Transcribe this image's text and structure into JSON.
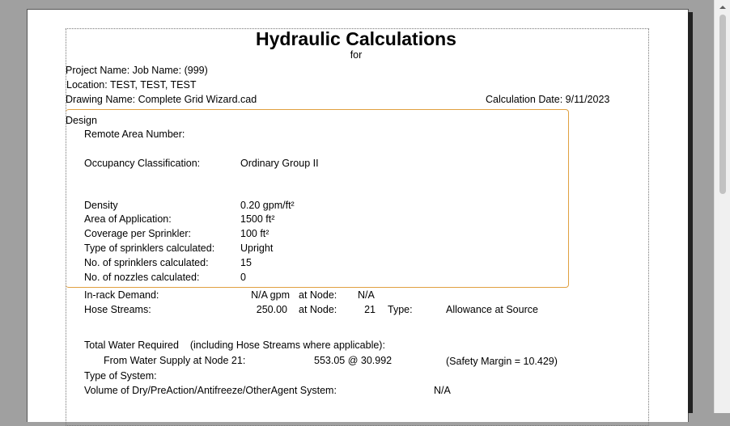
{
  "header": {
    "title": "Hydraulic Calculations",
    "subtitle": "for"
  },
  "project": {
    "project_name": "Project Name: Job Name: (999)",
    "location": "Location: TEST, TEST, TEST",
    "drawing_name": "Drawing Name: Complete Grid Wizard.cad",
    "calculation_date": "Calculation Date: 9/11/2023"
  },
  "design": {
    "heading": "Design",
    "remote_area_label": "Remote Area Number:",
    "occupancy_label": "Occupancy Classification:",
    "occupancy_value": "Ordinary Group II",
    "density_label": "Density",
    "density_value": "0.20 gpm/ft²",
    "area_label": "Area of Application:",
    "area_value": "1500 ft²",
    "coverage_label": "Coverage per Sprinkler:",
    "coverage_value": "100 ft²",
    "type_label": "Type of sprinklers calculated:",
    "type_value": "Upright",
    "num_sprinklers_label": "No. of sprinklers calculated:",
    "num_sprinklers_value": "15",
    "num_nozzles_label": "No. of nozzles calculated:",
    "num_nozzles_value": "0"
  },
  "demand": {
    "inrack_label": "In-rack Demand:",
    "inrack_value": "N/A gpm",
    "inrack_node_label": "at Node:",
    "inrack_node_value": "N/A",
    "hose_label": "Hose Streams:",
    "hose_value": "250.00",
    "hose_node_label": "at Node:",
    "hose_node_value": "21",
    "hose_type_label": "Type:",
    "hose_type_value": "Allowance at Source"
  },
  "totals": {
    "total_label": "Total Water Required    (including Hose Streams where applicable):",
    "supply_label": "From Water Supply at Node 21:",
    "supply_value": "553.05 @ 30.992",
    "safety_margin": "(Safety Margin = 10.429)",
    "system_type_label": "Type of System:",
    "volume_label": "Volume of Dry/PreAction/Antifreeze/OtherAgent System:",
    "volume_value": "N/A"
  }
}
